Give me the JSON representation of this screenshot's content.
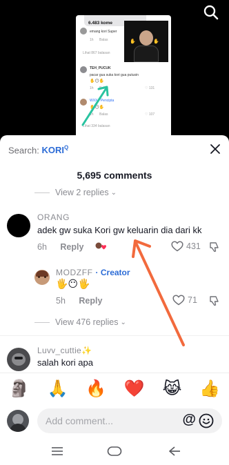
{
  "screenshot": {
    "count_label": "6.483 kome",
    "rows": [
      {
        "user": "emang kori Super",
        "meta": ""
      },
      {
        "user": "Lihat 867 balasan",
        "meta": ""
      },
      {
        "user": "TEH_PUCUK",
        "text": "pacar gua suka kori gua putusin",
        "meta": "1h",
        "likes": "131"
      },
      {
        "user": "WXX · Pencipta",
        "meta": "1h",
        "likes": "107"
      },
      {
        "user": "Lihat 334 balasan",
        "meta": ""
      }
    ],
    "balas": "Balas"
  },
  "header": {
    "search_prefix": "Search:",
    "search_keyword": "KORI",
    "comment_count": "5,695 comments"
  },
  "comments": {
    "view_replies_top": "View 2 replies",
    "main": {
      "username": "ORANG",
      "text": "adek gw suka Kori gw keluarin dia dari kk",
      "time": "6h",
      "reply": "Reply",
      "likes": "431"
    },
    "creator_reply": {
      "username": "MODZFF",
      "creator_label": "· Creator",
      "emojis": "🖐😶🖐",
      "time": "5h",
      "reply": "Reply",
      "likes": "71"
    },
    "view_replies_more": "View 476 replies",
    "next": {
      "username": "Luvv_cuttie✨",
      "text": "salah kori apa"
    }
  },
  "emoji_bar": [
    "🗿",
    "🙏",
    "🔥",
    "❤️",
    "😹",
    "👍"
  ],
  "input": {
    "placeholder": "Add comment...",
    "at_symbol": "@"
  },
  "colors": {
    "accent": "#2b6bd6",
    "arrow": "#f26a3d",
    "teal_arrow": "#29c3a0"
  },
  "icons": [
    "search-icon",
    "close-icon",
    "heart-outline-icon",
    "dislike-icon",
    "smile-icon",
    "menu-icon",
    "home-icon",
    "back-icon"
  ]
}
